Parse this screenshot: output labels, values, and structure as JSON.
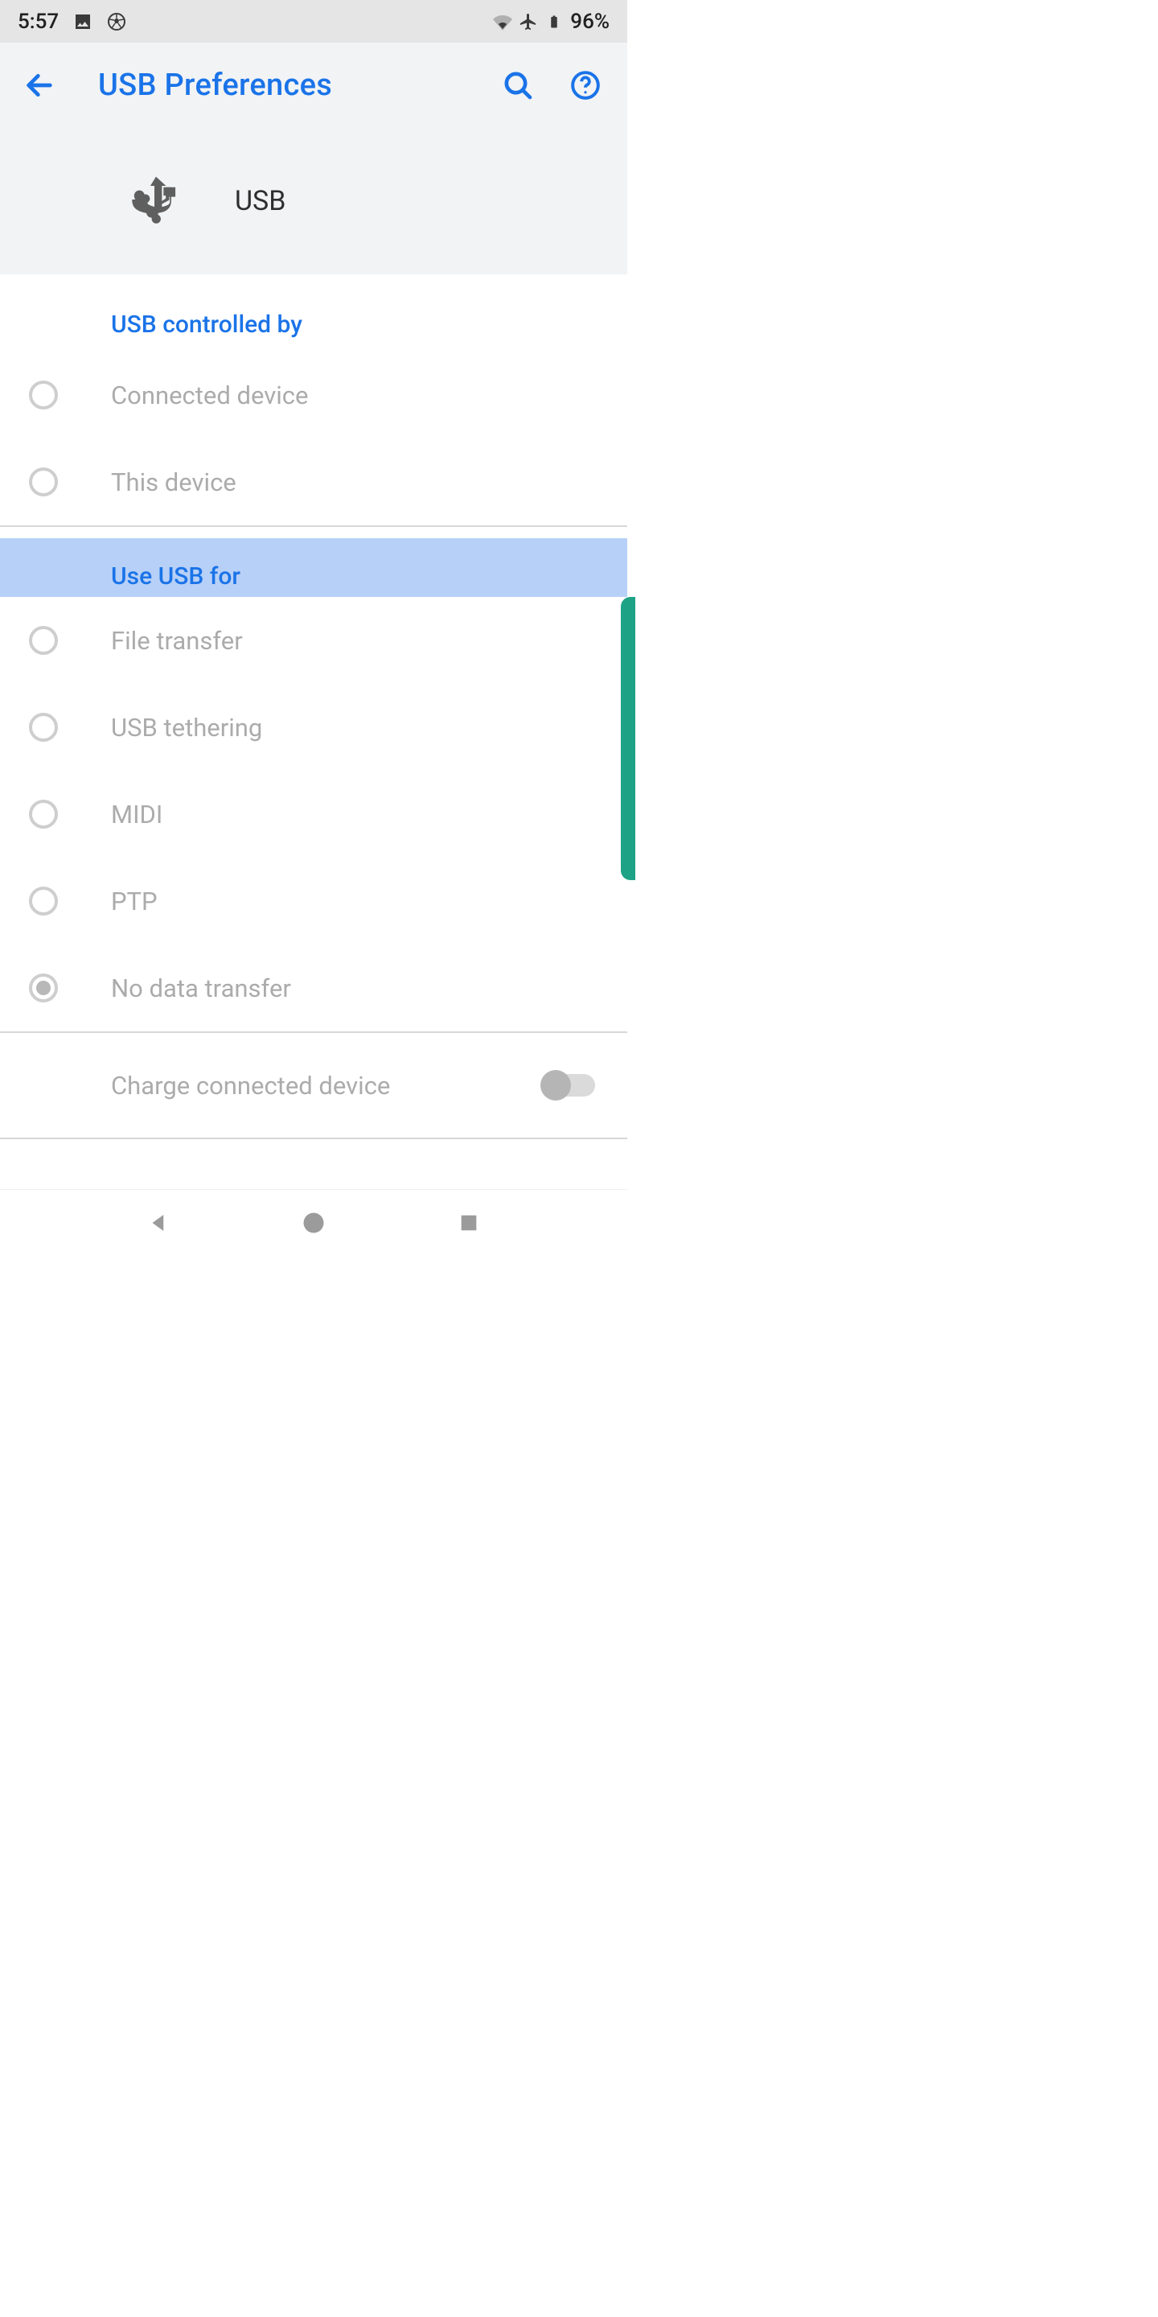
{
  "status_bar": {
    "time": "5:57",
    "battery_pct": "96%"
  },
  "header": {
    "title": "USB Preferences",
    "hero_label": "USB"
  },
  "sections": {
    "controlled_by": {
      "title": "USB controlled by",
      "options": [
        {
          "label": "Connected device",
          "selected": false
        },
        {
          "label": "This device",
          "selected": false
        }
      ]
    },
    "use_for": {
      "title": "Use USB for",
      "options": [
        {
          "label": "File transfer",
          "selected": false
        },
        {
          "label": "USB tethering",
          "selected": false
        },
        {
          "label": "MIDI",
          "selected": false
        },
        {
          "label": "PTP",
          "selected": false
        },
        {
          "label": "No data transfer",
          "selected": true
        }
      ]
    },
    "charge": {
      "label": "Charge connected device",
      "enabled": false
    }
  }
}
